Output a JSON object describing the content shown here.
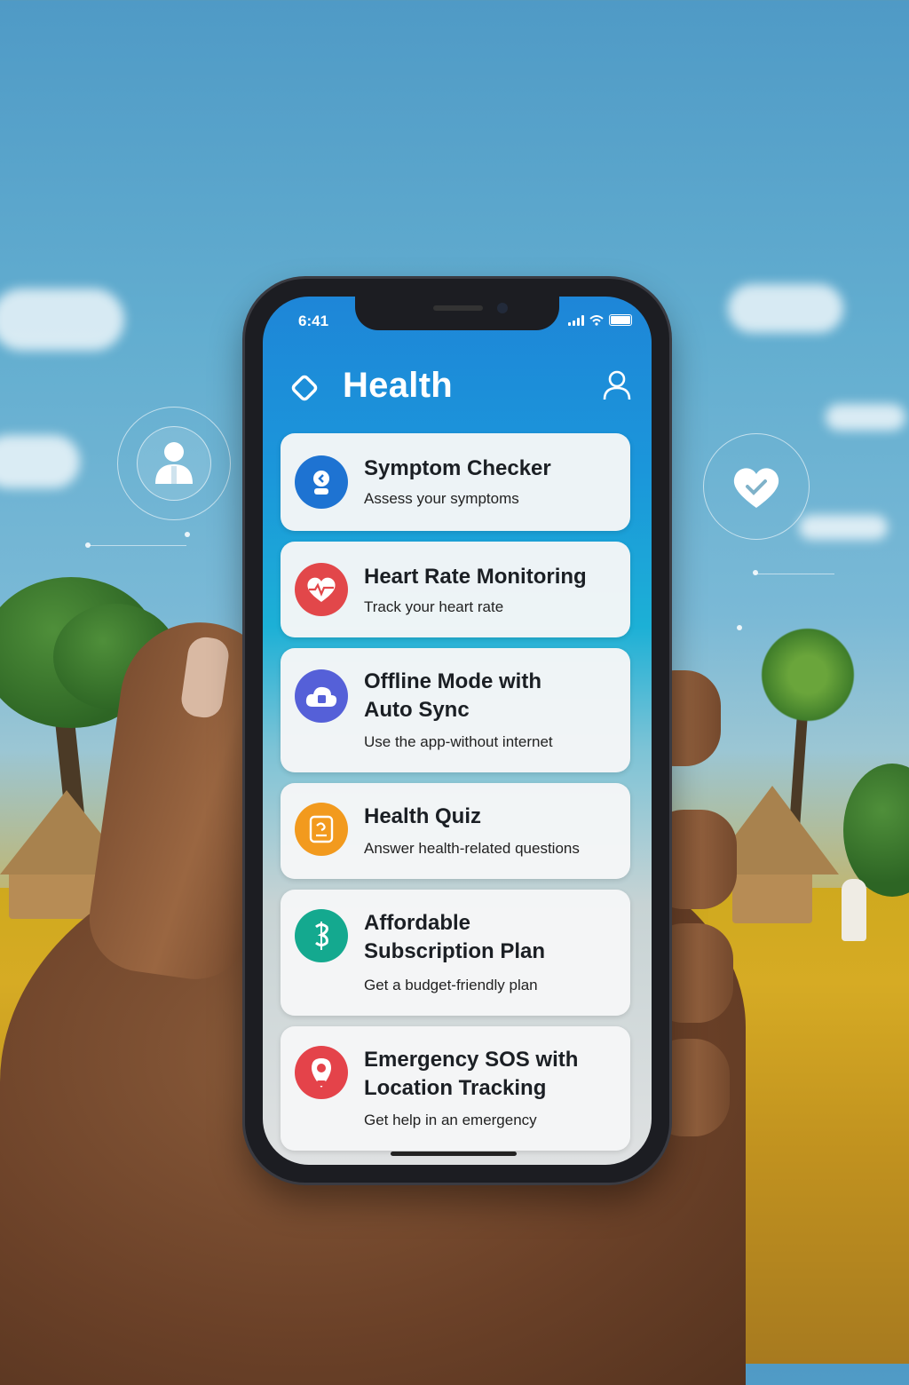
{
  "status_bar": {
    "time": "6:41"
  },
  "header": {
    "title": "Health",
    "logo_icon": "diamond-icon",
    "profile_icon": "user-icon"
  },
  "cards": [
    {
      "title": "Symptom Checker",
      "subtitle": "Assess your symptoms",
      "icon": "stethoscope-icon",
      "color": "#1e73d2"
    },
    {
      "title": "Heart Rate Monitoring",
      "subtitle": "Track your heart rate",
      "icon": "heart-pulse-icon",
      "color": "#e2474a"
    },
    {
      "title": "Offline Mode with Auto Sync",
      "subtitle": "Use the app-without internet",
      "icon": "cloud-icon",
      "color": "#5560d8"
    },
    {
      "title": "Health Quiz",
      "subtitle": "Answer health-related questions",
      "icon": "quiz-icon",
      "color": "#f29a1e"
    },
    {
      "title": "Affordable Subscription Plan",
      "subtitle": "Get a budget-friendly plan",
      "icon": "coin-icon",
      "color": "#14a98f"
    },
    {
      "title": "Emergency SOS with Location Tracking",
      "subtitle": "Get help in an emergency",
      "icon": "location-pin-icon",
      "color": "#e4434a"
    }
  ]
}
